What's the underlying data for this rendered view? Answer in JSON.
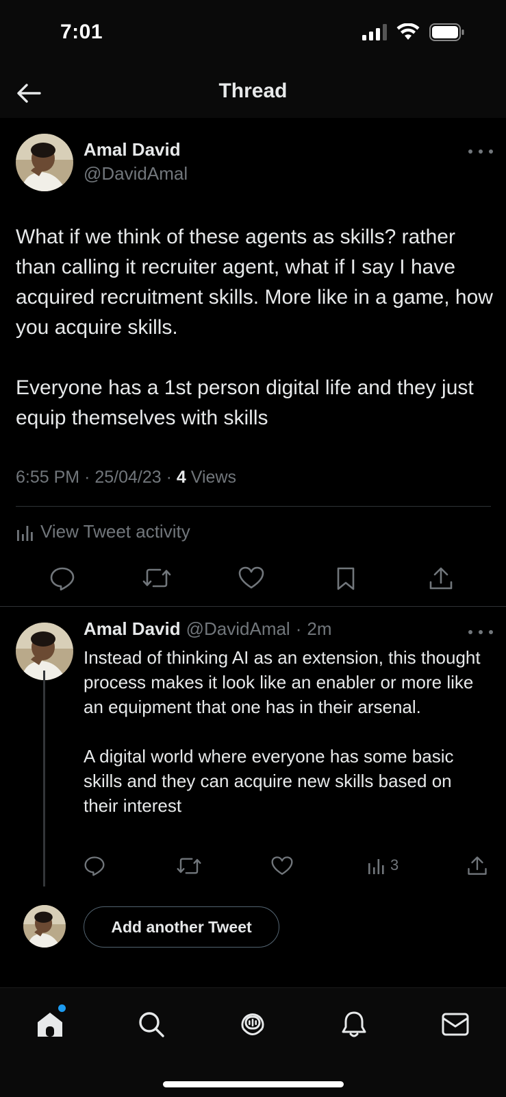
{
  "status": {
    "time": "7:01"
  },
  "nav": {
    "title": "Thread"
  },
  "tweet": {
    "author_name": "Amal David",
    "author_handle": "@DavidAmal",
    "paragraphs": [
      "What if we think of these agents as skills? rather than calling it recruiter agent, what if I say I have acquired recruitment skills. More like in a game, how you acquire skills.",
      "Everyone has a 1st person digital life and they just equip themselves with skills"
    ],
    "time": "6:55 PM",
    "date": "25/04/23",
    "views_count": "4",
    "views_label": "Views",
    "activity_label": "View Tweet activity"
  },
  "reply": {
    "author_name": "Amal David",
    "author_handle": "@DavidAmal",
    "age": "2m",
    "paragraphs": [
      "Instead of thinking AI as an extension, this thought process makes it look like an enabler or more like an equipment that one has in their arsenal.",
      "A digital world where everyone has some basic skills and they can acquire new skills based on their interest"
    ],
    "views_count": "3"
  },
  "compose": {
    "add_label": "Add another Tweet"
  },
  "icons": {
    "back": "arrow-left-icon",
    "more": "more-horizontal-icon",
    "reply": "comment-icon",
    "retweet": "retweet-icon",
    "like": "heart-icon",
    "bookmark": "bookmark-icon",
    "share": "share-icon",
    "analytics": "bar-chart-icon",
    "home": "home-icon",
    "search": "search-icon",
    "spaces": "spaces-icon",
    "notifications": "bell-icon",
    "messages": "mail-icon"
  },
  "colors": {
    "background": "#000000",
    "text": "#e7e9ea",
    "muted": "#71767b",
    "accent": "#1d9bf0",
    "divider": "#2f3336"
  }
}
